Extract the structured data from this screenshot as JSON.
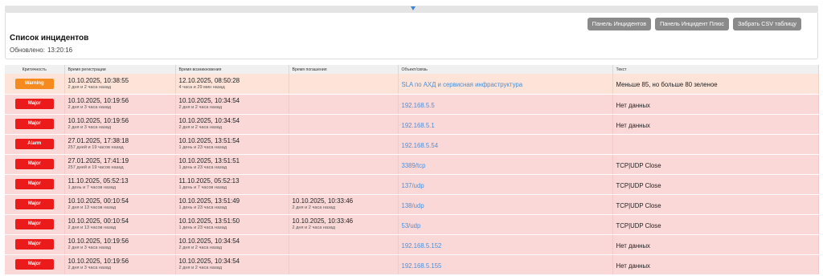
{
  "panel": {
    "title": "Список инцидентов",
    "updated_label": "Обновлено:",
    "updated_time": "13:20:16"
  },
  "toolbar": {
    "incidents_panel": "Панель Инцидентов",
    "incident_plus_panel": "Панель Инцидент Плюс",
    "csv_button": "Забрать CSV таблицу"
  },
  "table": {
    "columns": [
      "Критичность",
      "Время регистрации",
      "Время возникновения",
      "Время погашения",
      "Объект/связь",
      "Текст"
    ],
    "rows": [
      {
        "severity": "Warning",
        "reg": "10.10.2025, 10:38:55",
        "reg_ago": "2 дня и 2 часа назад",
        "occ": "12.10.2025, 08:50:28",
        "occ_ago": "4 часа и 29 мин назад",
        "res": "",
        "res_ago": "",
        "object": "SLA по АХД и сервисная инфраструктура",
        "text": "Меньше 85, но больше 80 зеленое"
      },
      {
        "severity": "Major",
        "reg": "10.10.2025, 10:19:56",
        "reg_ago": "2 дня и 3 часа назад",
        "occ": "10.10.2025, 10:34:54",
        "occ_ago": "2 дня и 2 часа назад",
        "res": "",
        "res_ago": "",
        "object": "192.168.5.5",
        "text": "Нет данных"
      },
      {
        "severity": "Major",
        "reg": "10.10.2025, 10:19:56",
        "reg_ago": "2 дня и 3 часа назад",
        "occ": "10.10.2025, 10:34:54",
        "occ_ago": "2 дня и 2 часа назад",
        "res": "",
        "res_ago": "",
        "object": "192.168.5.1",
        "text": "Нет данных"
      },
      {
        "severity": "Alarm",
        "reg": "27.01.2025, 17:38:18",
        "reg_ago": "257 дней и 19 часов назад",
        "occ": "10.10.2025, 13:51:54",
        "occ_ago": "1 день и 23 часа назад",
        "res": "",
        "res_ago": "",
        "object": "192.168.5.54",
        "text": ""
      },
      {
        "severity": "Major",
        "reg": "27.01.2025, 17:41:19",
        "reg_ago": "257 дней и 19 часов назад",
        "occ": "10.10.2025, 13:51:51",
        "occ_ago": "1 день и 23 часа назад",
        "res": "",
        "res_ago": "",
        "object": "3389/tcp",
        "text": "TCP|UDP Close"
      },
      {
        "severity": "Major",
        "reg": "11.10.2025, 05:52:13",
        "reg_ago": "1 день и 7 часов назад",
        "occ": "11.10.2025, 05:52:13",
        "occ_ago": "1 день и 7 часов назад",
        "res": "",
        "res_ago": "",
        "object": "137/udp",
        "text": "TCP|UDP Close"
      },
      {
        "severity": "Major",
        "reg": "10.10.2025, 00:10:54",
        "reg_ago": "2 дня и 13 часов назад",
        "occ": "10.10.2025, 13:51:49",
        "occ_ago": "1 день и 23 часа назад",
        "res": "10.10.2025, 10:33:46",
        "res_ago": "2 дня и 2 часа назад",
        "object": "138/udp",
        "text": "TCP|UDP Close"
      },
      {
        "severity": "Major",
        "reg": "10.10.2025, 00:10:54",
        "reg_ago": "2 дня и 13 часов назад",
        "occ": "10.10.2025, 13:51:50",
        "occ_ago": "1 день и 23 часа назад",
        "res": "10.10.2025, 10:33:46",
        "res_ago": "2 дня и 2 часа назад",
        "object": "53/udp",
        "text": "TCP|UDP Close"
      },
      {
        "severity": "Major",
        "reg": "10.10.2025, 10:19:56",
        "reg_ago": "2 дня и 3 часа назад",
        "occ": "10.10.2025, 10:34:54",
        "occ_ago": "2 дня и 2 часа назад",
        "res": "",
        "res_ago": "",
        "object": "192.168.5.152",
        "text": "Нет данных"
      },
      {
        "severity": "Major",
        "reg": "10.10.2025, 10:19:56",
        "reg_ago": "2 дня и 3 часа назад",
        "occ": "10.10.2025, 10:34:54",
        "occ_ago": "2 дня и 2 часа назад",
        "res": "",
        "res_ago": "",
        "object": "192.168.5.155",
        "text": "Нет данных"
      }
    ]
  },
  "colors": {
    "major": "#ec1b1b",
    "warning": "#f58a1f",
    "row_major": "#fbd8d8",
    "row_warning": "#fde3d8",
    "link": "#4a90d9",
    "toolbar_button": "#8a8a8a"
  },
  "icons": {
    "collapse": "chevron-down-icon"
  }
}
